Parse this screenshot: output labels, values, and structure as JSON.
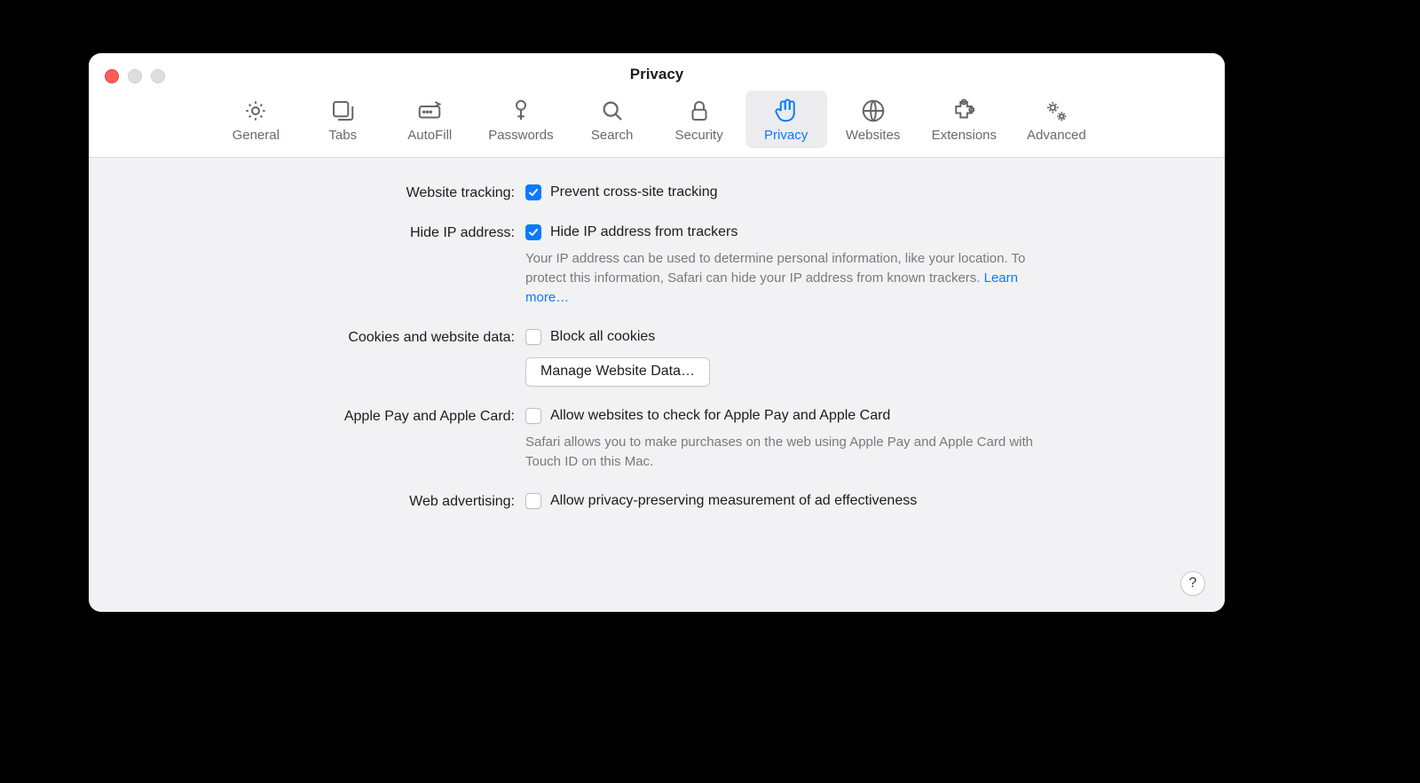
{
  "window": {
    "title": "Privacy"
  },
  "toolbar": {
    "items": [
      {
        "id": "general",
        "label": "General"
      },
      {
        "id": "tabs",
        "label": "Tabs"
      },
      {
        "id": "autofill",
        "label": "AutoFill"
      },
      {
        "id": "passwords",
        "label": "Passwords"
      },
      {
        "id": "search",
        "label": "Search"
      },
      {
        "id": "security",
        "label": "Security"
      },
      {
        "id": "privacy",
        "label": "Privacy"
      },
      {
        "id": "websites",
        "label": "Websites"
      },
      {
        "id": "extensions",
        "label": "Extensions"
      },
      {
        "id": "advanced",
        "label": "Advanced"
      }
    ],
    "active": "privacy"
  },
  "sections": {
    "tracking": {
      "title": "Website tracking:",
      "checkbox_label": "Prevent cross-site tracking",
      "checked": true
    },
    "hide_ip": {
      "title": "Hide IP address:",
      "checkbox_label": "Hide IP address from trackers",
      "checked": true,
      "description": "Your IP address can be used to determine personal information, like your location. To protect this information, Safari can hide your IP address from known trackers. ",
      "learn_more": "Learn more…"
    },
    "cookies": {
      "title": "Cookies and website data:",
      "checkbox_label": "Block all cookies",
      "checked": false,
      "button_label": "Manage Website Data…"
    },
    "apple_pay": {
      "title": "Apple Pay and Apple Card:",
      "checkbox_label": "Allow websites to check for Apple Pay and Apple Card",
      "checked": false,
      "description": "Safari allows you to make purchases on the web using Apple Pay and Apple Card with Touch ID on this Mac."
    },
    "web_ads": {
      "title": "Web advertising:",
      "checkbox_label": "Allow privacy-preserving measurement of ad effectiveness",
      "checked": false
    }
  },
  "help_button": "?"
}
